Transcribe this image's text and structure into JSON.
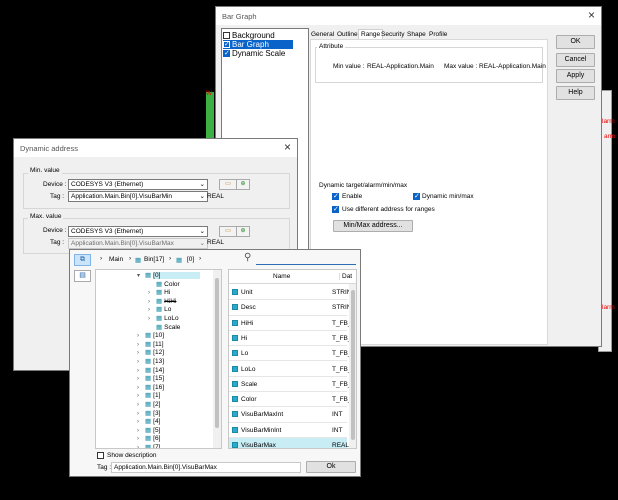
{
  "bar_graph": {
    "title": "Bar Graph",
    "close": "×",
    "list_items": [
      {
        "label": "Background",
        "checked": false,
        "selected": false
      },
      {
        "label": "Bar Graph",
        "checked": true,
        "selected": true
      },
      {
        "label": "Dynamic Scale",
        "checked": true,
        "selected": false
      }
    ],
    "tabs": [
      "General",
      "Outline",
      "Range",
      "Security",
      "Shape",
      "Profile"
    ],
    "active_tab": "Range",
    "attribute_title": "Attribute",
    "min_label": "Min value :",
    "min_value": "REAL-Application.Main",
    "max_label": "Max value :",
    "max_value": "REAL-Application.Main",
    "dyn_title": "Dynamic target/alarm/min/max",
    "enable_label": "Enable",
    "dynamic_minmax_label": "Dynamic min/max",
    "use_diff_label": "Use different address for ranges",
    "minmax_btn": "Min/Max address...",
    "buttons": {
      "ok": "OK",
      "cancel": "Cancel",
      "apply": "Apply",
      "help": "Help"
    }
  },
  "dynamic_address": {
    "title": "Dynamic address",
    "close": "×",
    "min_group": "Min. value",
    "max_group": "Max. value",
    "device_label": "Device :",
    "tag_label": "Tag :",
    "device_value": "CODESYS V3 (Ethernet)",
    "min_tag": "Application.Main.Bin[0].VisuBarMin",
    "max_tag": "Application.Main.Bin[0].VisuBarMax",
    "type": "REAL"
  },
  "tag_browser": {
    "breadcrumb": [
      "Main",
      "Bin[17]",
      "[0]"
    ],
    "tree": [
      {
        "label": "[0]",
        "level": 0,
        "arrow": "▾",
        "selected": true
      },
      {
        "label": "Color",
        "level": 1,
        "arrow": ""
      },
      {
        "label": "Hi",
        "level": 1,
        "arrow": "›"
      },
      {
        "label": "HiHi",
        "level": 1,
        "arrow": "›"
      },
      {
        "label": "Lo",
        "level": 1,
        "arrow": "›"
      },
      {
        "label": "LoLo",
        "level": 1,
        "arrow": "›"
      },
      {
        "label": "Scale",
        "level": 1,
        "arrow": ""
      },
      {
        "label": "[10]",
        "level": 0,
        "arrow": "›"
      },
      {
        "label": "[11]",
        "level": 0,
        "arrow": "›"
      },
      {
        "label": "[12]",
        "level": 0,
        "arrow": "›"
      },
      {
        "label": "[13]",
        "level": 0,
        "arrow": "›"
      },
      {
        "label": "[14]",
        "level": 0,
        "arrow": "›"
      },
      {
        "label": "[15]",
        "level": 0,
        "arrow": "›"
      },
      {
        "label": "[16]",
        "level": 0,
        "arrow": "›"
      },
      {
        "label": "[1]",
        "level": 0,
        "arrow": "›"
      },
      {
        "label": "[2]",
        "level": 0,
        "arrow": "›"
      },
      {
        "label": "[3]",
        "level": 0,
        "arrow": "›"
      },
      {
        "label": "[4]",
        "level": 0,
        "arrow": "›"
      },
      {
        "label": "[5]",
        "level": 0,
        "arrow": "›"
      },
      {
        "label": "[6]",
        "level": 0,
        "arrow": "›"
      },
      {
        "label": "[7]",
        "level": 0,
        "arrow": "›"
      }
    ],
    "columns": {
      "name": "Name",
      "data": "Dat"
    },
    "rows": [
      {
        "name": "Unit",
        "type": "STRIN",
        "selected": false
      },
      {
        "name": "Desc",
        "type": "STRIN",
        "selected": false
      },
      {
        "name": "HiHi",
        "type": "T_FB_",
        "selected": false
      },
      {
        "name": "Hi",
        "type": "T_FB_",
        "selected": false
      },
      {
        "name": "Lo",
        "type": "T_FB_",
        "selected": false
      },
      {
        "name": "LoLo",
        "type": "T_FB_",
        "selected": false
      },
      {
        "name": "Scale",
        "type": "T_FB_",
        "selected": false
      },
      {
        "name": "Color",
        "type": "T_FB_",
        "selected": false
      },
      {
        "name": "VisuBarMaxInt",
        "type": "INT",
        "selected": false
      },
      {
        "name": "VisuBarMinInt",
        "type": "INT",
        "selected": false
      },
      {
        "name": "VisuBarMax",
        "type": "REAL",
        "selected": true
      }
    ],
    "show_description": "Show description",
    "tag_label": "Tag :",
    "tag_value": "Application.Main.Bin[0].VisuBarMax",
    "ok": "Ok"
  },
  "bg_fragments": [
    "larm",
    "arm",
    "larm",
    "W"
  ]
}
